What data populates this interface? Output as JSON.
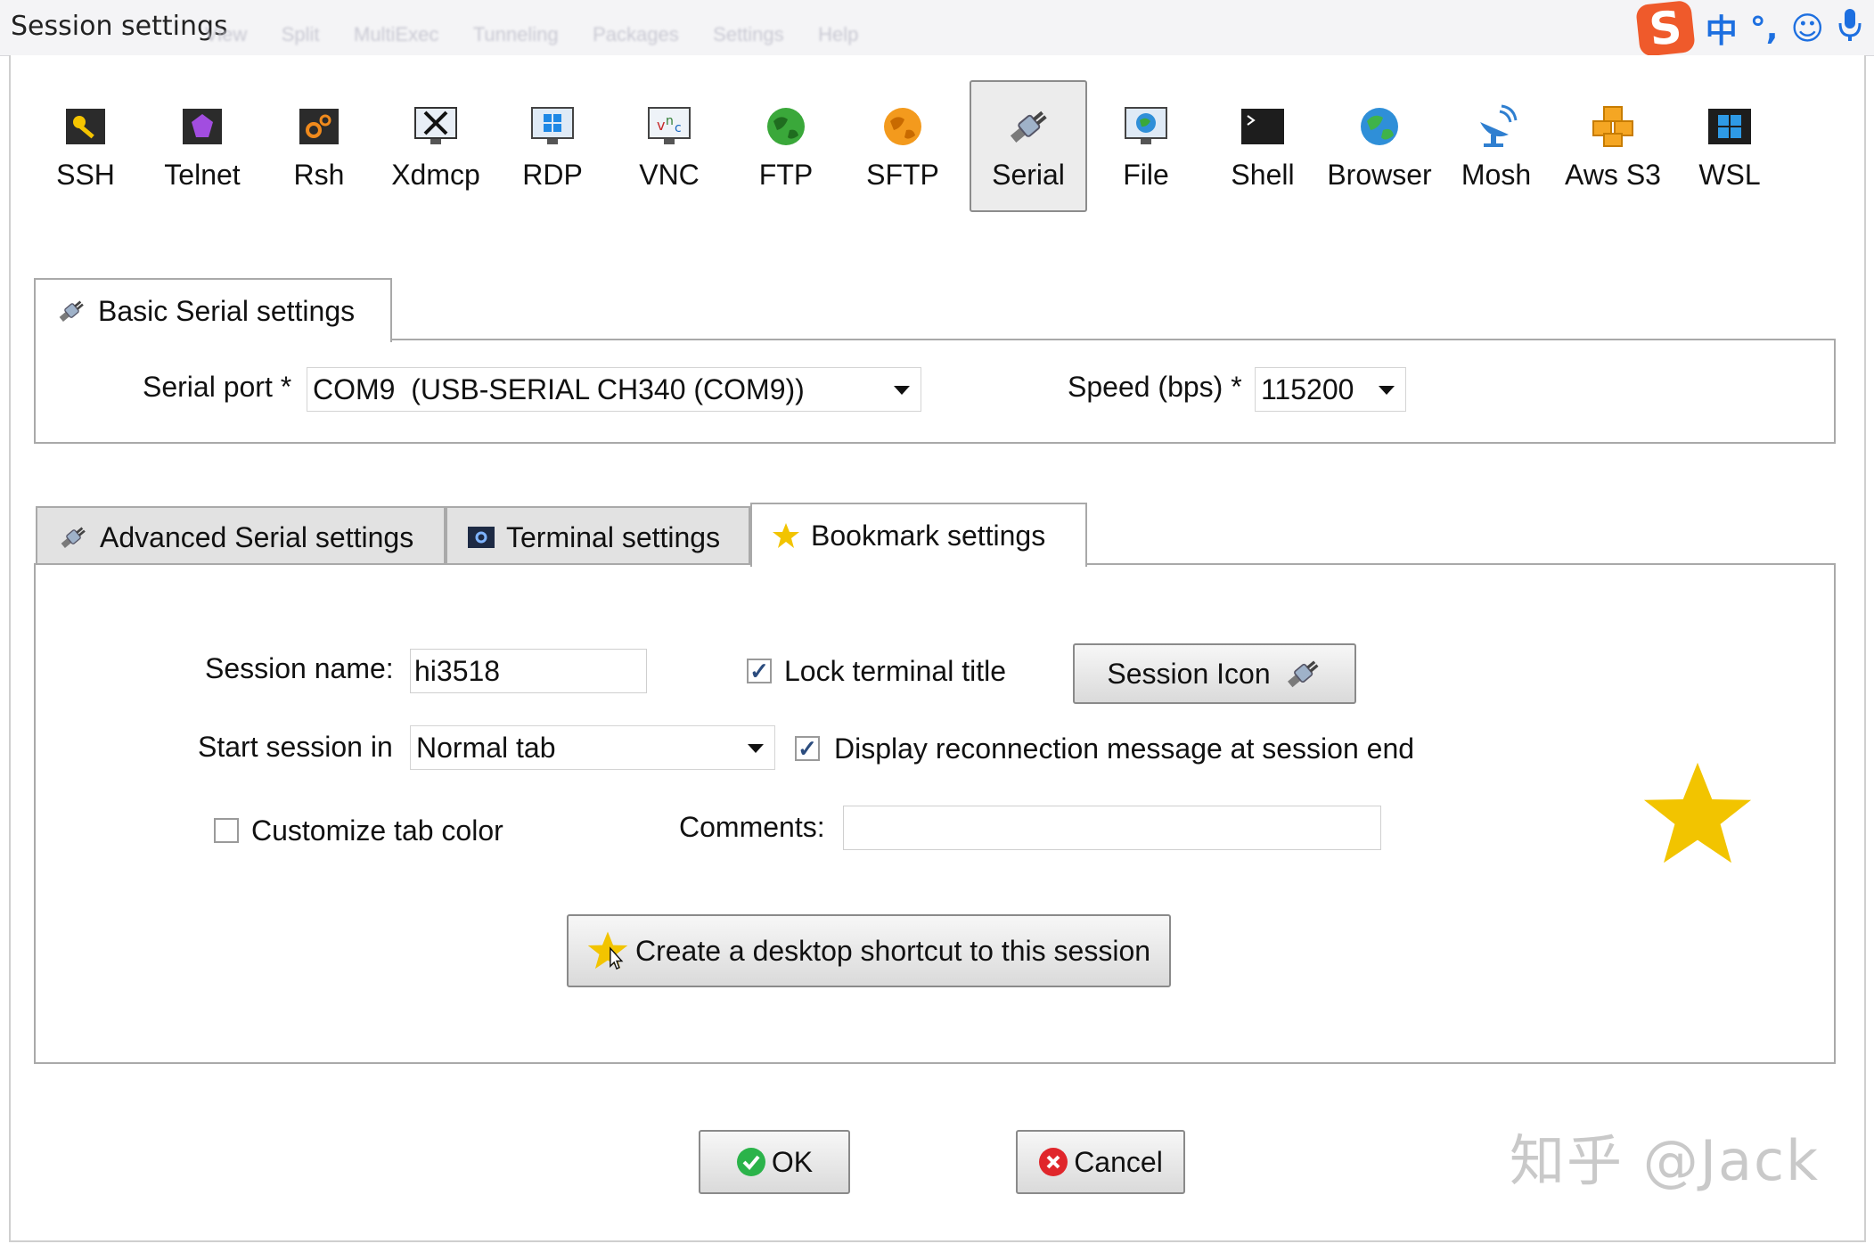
{
  "window": {
    "title": "Session settings",
    "background_menu": [
      "View",
      "Split",
      "MultiExec",
      "Tunneling",
      "Packages",
      "Settings",
      "Help"
    ]
  },
  "ime": {
    "logo": "S",
    "items": [
      "中",
      "°,",
      "☺",
      "🎤"
    ]
  },
  "session_types": [
    {
      "label": "SSH",
      "icon": "key-icon"
    },
    {
      "label": "Telnet",
      "icon": "gem-icon"
    },
    {
      "label": "Rsh",
      "icon": "gears-icon"
    },
    {
      "label": "Xdmcp",
      "icon": "x-monitor-icon"
    },
    {
      "label": "RDP",
      "icon": "windows-monitor-icon"
    },
    {
      "label": "VNC",
      "icon": "vnc-monitor-icon"
    },
    {
      "label": "FTP",
      "icon": "green-globe-icon"
    },
    {
      "label": "SFTP",
      "icon": "orange-globe-icon"
    },
    {
      "label": "Serial",
      "icon": "serial-plug-icon"
    },
    {
      "label": "File",
      "icon": "file-monitor-icon"
    },
    {
      "label": "Shell",
      "icon": "terminal-icon"
    },
    {
      "label": "Browser",
      "icon": "browser-globe-icon"
    },
    {
      "label": "Mosh",
      "icon": "satellite-dish-icon"
    },
    {
      "label": "Aws S3",
      "icon": "aws-boxes-icon"
    },
    {
      "label": "WSL",
      "icon": "windows-logo-icon"
    }
  ],
  "selected_session_type": "Serial",
  "basic": {
    "tab_label": "Basic Serial settings",
    "serial_port_label": "Serial port *",
    "serial_port_value": "COM9  (USB-SERIAL CH340 (COM9))",
    "speed_label": "Speed (bps) *",
    "speed_value": "115200"
  },
  "lower_tabs": {
    "advanced": "Advanced Serial settings",
    "terminal": "Terminal settings",
    "bookmark": "Bookmark settings",
    "selected": "bookmark"
  },
  "bookmark": {
    "session_name_label": "Session name:",
    "session_name_value": "hi3518",
    "lock_title_label": "Lock terminal title",
    "lock_title_checked": true,
    "session_icon_button": "Session Icon",
    "start_in_label": "Start session in",
    "start_in_value": "Normal tab",
    "reconnect_label": "Display reconnection message at session end",
    "reconnect_checked": true,
    "tab_color_label": "Customize tab color",
    "tab_color_checked": false,
    "comments_label": "Comments:",
    "comments_value": "",
    "shortcut_button": "Create a desktop shortcut to this session"
  },
  "footer": {
    "ok_label": "OK",
    "cancel_label": "Cancel"
  },
  "watermark": "知乎 @Jack",
  "colors": {
    "star": "#f2c400",
    "ok_green": "#2bb34a",
    "cancel_red": "#e0262b",
    "check_blue": "#2b4c7e"
  }
}
